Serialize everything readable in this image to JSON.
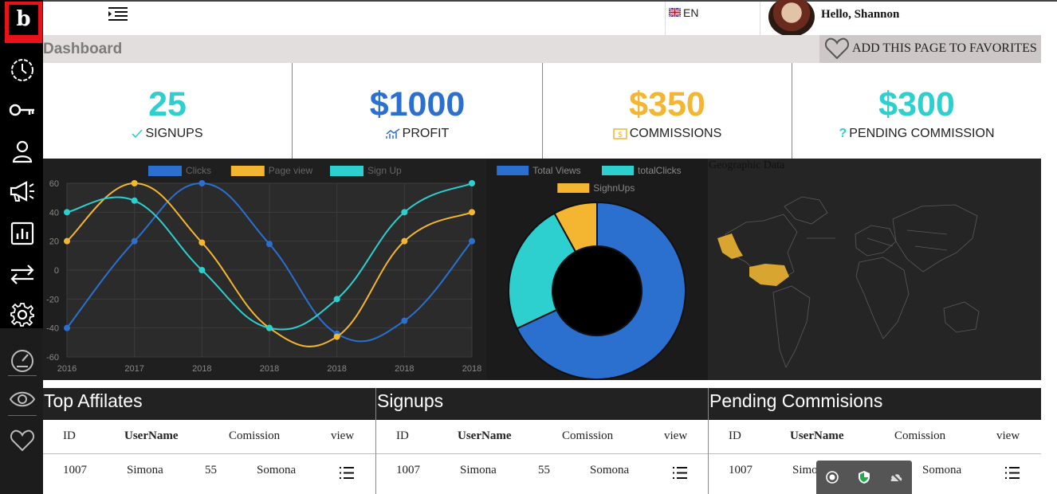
{
  "brand": {
    "logo_letter": "b",
    "accent": "#e8131a"
  },
  "sidebar": {
    "items": [
      {
        "name": "clock-icon"
      },
      {
        "name": "key-icon"
      },
      {
        "name": "user-icon"
      },
      {
        "name": "megaphone-icon"
      },
      {
        "name": "report-icon"
      },
      {
        "name": "transfer-icon"
      },
      {
        "name": "gear-icon"
      },
      {
        "name": "speedometer-icon"
      },
      {
        "name": "eye-icon"
      },
      {
        "name": "heart-icon"
      }
    ]
  },
  "topbar": {
    "language": "EN",
    "greeting": "Hello, Shannon"
  },
  "header": {
    "title": "Dashboard",
    "favorite_label": "ADD THIS PAGE TO FAVORITES"
  },
  "stats": [
    {
      "value": "25",
      "label": "SIGNUPS",
      "icon": "check-icon",
      "color": "#2ecfcf"
    },
    {
      "value": "$1000",
      "label": "PROFIT",
      "icon": "chart-icon",
      "color": "#2b6fcf"
    },
    {
      "value": "$350",
      "label": "COMMISSIONS",
      "icon": "dollar-icon",
      "color": "#f4b630"
    },
    {
      "value": "$300",
      "label": "PENDING COMMISSION",
      "icon": "question-icon",
      "color": "#2ecfcf"
    }
  ],
  "chart_data": [
    {
      "type": "line",
      "x": [
        "2016",
        "2017",
        "2018",
        "2018",
        "2018",
        "2018",
        "2018"
      ],
      "ylim": [
        -60,
        60
      ],
      "yticks": [
        60,
        40,
        20,
        0,
        -20,
        -40,
        -60
      ],
      "grid": true,
      "legend": "top",
      "series": [
        {
          "name": "Clicks",
          "color": "#2b6fcf",
          "values": [
            -40,
            20,
            60,
            18,
            -44,
            -35,
            20
          ]
        },
        {
          "name": "Page view",
          "color": "#f4b630",
          "values": [
            20,
            60,
            19,
            -40,
            -46,
            20,
            40
          ]
        },
        {
          "name": "Sign Up",
          "color": "#2ecfcf",
          "values": [
            40,
            48,
            0,
            -40,
            -20,
            40,
            60
          ]
        }
      ]
    },
    {
      "type": "pie",
      "legend": "top",
      "categories": [
        "Total Views",
        "totalClicks",
        "SighnUps"
      ],
      "values": [
        68,
        24,
        8
      ],
      "colors": [
        "#2b6fcf",
        "#2ecfcf",
        "#f4b630"
      ]
    }
  ],
  "geo": {
    "title": "Geographic Data",
    "highlight_color": "#d8a531"
  },
  "tables": [
    {
      "title": "Top Affilates",
      "columns": [
        "ID",
        "UserName",
        "Comission",
        "view"
      ],
      "row": {
        "id": "1007",
        "username": "Simona",
        "commission": "55",
        "name": "Somona"
      }
    },
    {
      "title": "Signups",
      "columns": [
        "ID",
        "UserName",
        "Comission",
        "view"
      ],
      "row": {
        "id": "1007",
        "username": "Simona",
        "commission": "55",
        "name": "Somona"
      }
    },
    {
      "title": "Pending Commisions",
      "columns": [
        "ID",
        "UserName",
        "Comission",
        "view"
      ],
      "row": {
        "id": "1007",
        "username": "Simona",
        "commission": "55",
        "name": "Somona"
      }
    }
  ],
  "overlay": {
    "icons": [
      "record-icon",
      "shield-icon",
      "cloud-off-icon"
    ]
  }
}
